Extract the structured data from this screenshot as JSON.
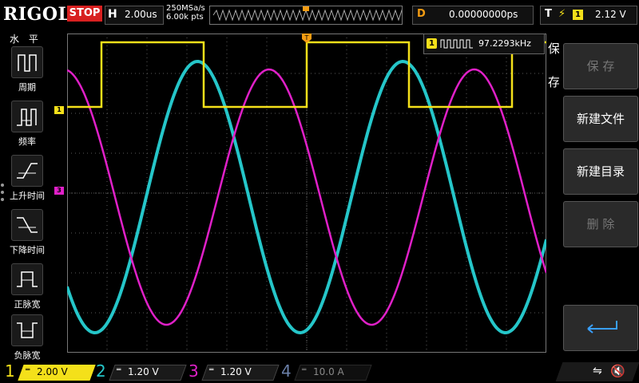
{
  "header": {
    "brand": "RIGOL",
    "run_state": "STOP",
    "horizontal": {
      "label": "H",
      "timebase": "2.00us"
    },
    "acquisition": {
      "sample_rate": "250MSa/s",
      "points": "6.00k pts"
    },
    "delay": {
      "label": "D",
      "value": "0.00000000ps"
    },
    "trigger": {
      "label": "T",
      "edge": "rising-edge-icon",
      "source": "1",
      "level": "2.12 V"
    }
  },
  "left_menu": {
    "title": "水 平",
    "items": [
      {
        "label": "周期",
        "icon": "period-icon"
      },
      {
        "label": "频率",
        "icon": "frequency-icon"
      },
      {
        "label": "上升时间",
        "icon": "rise-time-icon"
      },
      {
        "label": "下降时间",
        "icon": "fall-time-icon"
      },
      {
        "label": "正脉宽",
        "icon": "positive-width-icon"
      },
      {
        "label": "负脉宽",
        "icon": "negative-width-icon"
      }
    ]
  },
  "right_menu": {
    "side_label": "保存",
    "buttons": [
      {
        "label": "保 存",
        "enabled": false
      },
      {
        "label": "新建文件",
        "enabled": true
      },
      {
        "label": "新建目录",
        "enabled": true
      },
      {
        "label": "删 除",
        "enabled": false
      },
      {
        "label": "",
        "icon": "return-arrow-icon",
        "enabled": true
      }
    ]
  },
  "measurement": {
    "channel": "1",
    "value": "97.2293kHz"
  },
  "channels": [
    {
      "num": "1",
      "scale": "2.00 V",
      "color": "#f4e01a"
    },
    {
      "num": "2",
      "scale": "1.20 V",
      "color": "#25c6c9"
    },
    {
      "num": "3",
      "scale": "1.20 V",
      "color": "#e020c8"
    },
    {
      "num": "4",
      "scale": "10.0 A",
      "color": "#6a7fa8"
    }
  ],
  "colors": {
    "ch1": "#f4e01a",
    "ch2": "#25c6c9",
    "ch3": "#e020c8",
    "trigger_marker": "#f39c12",
    "grid": "#5a5a5a"
  },
  "status_icons": [
    "usb-icon",
    "speaker-muted-icon"
  ]
}
